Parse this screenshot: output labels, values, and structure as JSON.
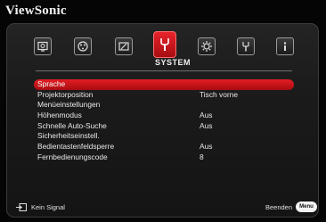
{
  "brand": "ViewSonic",
  "tabs": [
    {
      "icon": "picture-icon"
    },
    {
      "icon": "color-palette-icon"
    },
    {
      "icon": "adjust-icon"
    },
    {
      "icon": "wrench-icon",
      "active": true
    },
    {
      "icon": "gear-icon"
    },
    {
      "icon": "tools-icon"
    },
    {
      "icon": "info-icon"
    }
  ],
  "section_title": "SYSTEM",
  "menu": [
    {
      "label": "Sprache",
      "value": ""
    },
    {
      "label": "Projektorposition",
      "value": "Tisch vorne"
    },
    {
      "label": "Menüeinstellungen",
      "value": ""
    },
    {
      "label": "Höhenmodus",
      "value": "Aus"
    },
    {
      "label": "Schnelle Auto-Suche",
      "value": "Aus"
    },
    {
      "label": "Sicherheitseinstell.",
      "value": ""
    },
    {
      "label": "Bedientastenfeldsperre",
      "value": "Aus"
    },
    {
      "label": "Fernbedienungscode",
      "value": "8"
    }
  ],
  "selected_index": 0,
  "footer": {
    "signal_text": "Kein Signal",
    "exit_text": "Beenden",
    "exit_key": "Menu"
  },
  "colors": {
    "accent": "#d91a20",
    "text": "#e8e8e8"
  }
}
